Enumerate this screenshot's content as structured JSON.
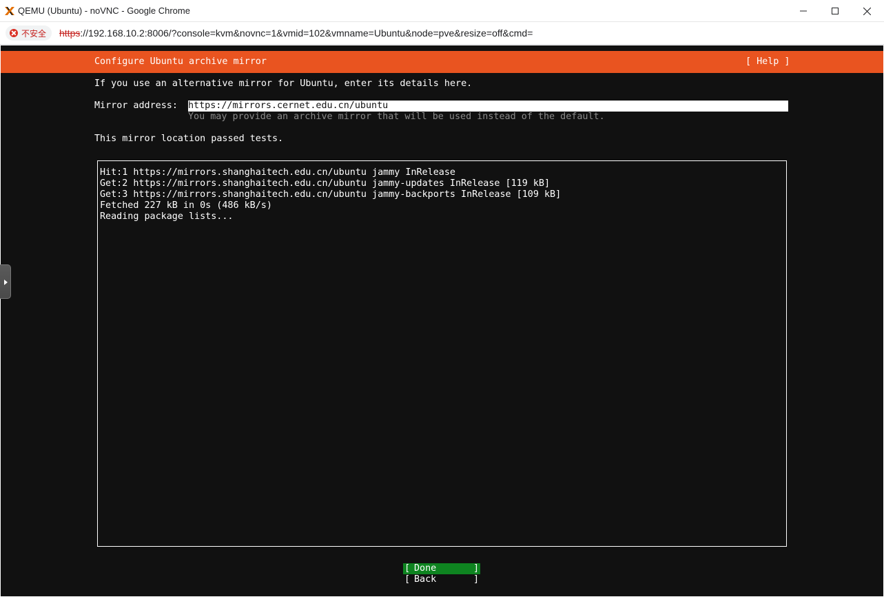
{
  "window": {
    "title": "QEMU (Ubuntu) - noVNC - Google Chrome"
  },
  "addressbar": {
    "security_label": "不安全",
    "url_scheme": "https",
    "url_rest": "://192.168.10.2:8006/?console=kvm&novnc=1&vmid=102&vmname=Ubuntu&node=pve&resize=off&cmd="
  },
  "installer": {
    "header_title": "Configure Ubuntu archive mirror",
    "help_label": "[ Help ]",
    "intro": "If you use an alternative mirror for Ubuntu, enter its details here.",
    "mirror_label": "Mirror address:",
    "mirror_value": "https://mirrors.cernet.edu.cn/ubuntu",
    "mirror_hint": "You may provide an archive mirror that will be used instead of the default.",
    "status": "This mirror location passed tests.",
    "log_lines": [
      "Hit:1 https://mirrors.shanghaitech.edu.cn/ubuntu jammy InRelease",
      "Get:2 https://mirrors.shanghaitech.edu.cn/ubuntu jammy-updates InRelease [119 kB]",
      "Get:3 https://mirrors.shanghaitech.edu.cn/ubuntu jammy-backports InRelease [109 kB]",
      "Fetched 227 kB in 0s (486 kB/s)",
      "Reading package lists..."
    ],
    "done_label": "Done",
    "back_label": "Back",
    "bracket_open": "[",
    "bracket_close": "]"
  },
  "colors": {
    "header_orange": "#e95420",
    "done_green": "#0e8420",
    "terminal_bg": "#111111"
  },
  "icons": {
    "app": "proxmox-x-icon",
    "security": "not-secure-icon",
    "sidebar_handle": "expand-arrow-icon"
  }
}
